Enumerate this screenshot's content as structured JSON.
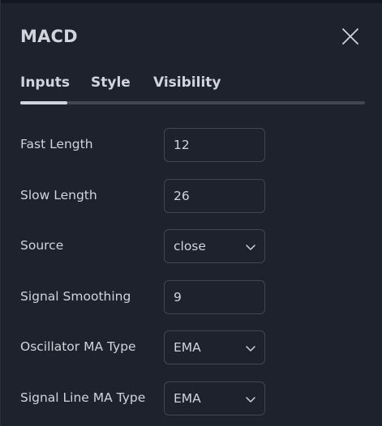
{
  "dialog": {
    "title": "MACD",
    "close_icon": "close-icon"
  },
  "tabs": [
    {
      "label": "Inputs",
      "active": true
    },
    {
      "label": "Style",
      "active": false
    },
    {
      "label": "Visibility",
      "active": false
    }
  ],
  "inputs": [
    {
      "label": "Fast Length",
      "value": "12",
      "kind": "number"
    },
    {
      "label": "Slow Length",
      "value": "26",
      "kind": "number"
    },
    {
      "label": "Source",
      "value": "close",
      "kind": "select"
    },
    {
      "label": "Signal Smoothing",
      "value": "9",
      "kind": "number"
    },
    {
      "label": "Oscillator MA Type",
      "value": "EMA",
      "kind": "select"
    },
    {
      "label": "Signal Line MA Type",
      "value": "EMA",
      "kind": "select"
    }
  ],
  "colors": {
    "background": "#1e222d",
    "text": "#d1d4dc",
    "border": "#434651"
  }
}
